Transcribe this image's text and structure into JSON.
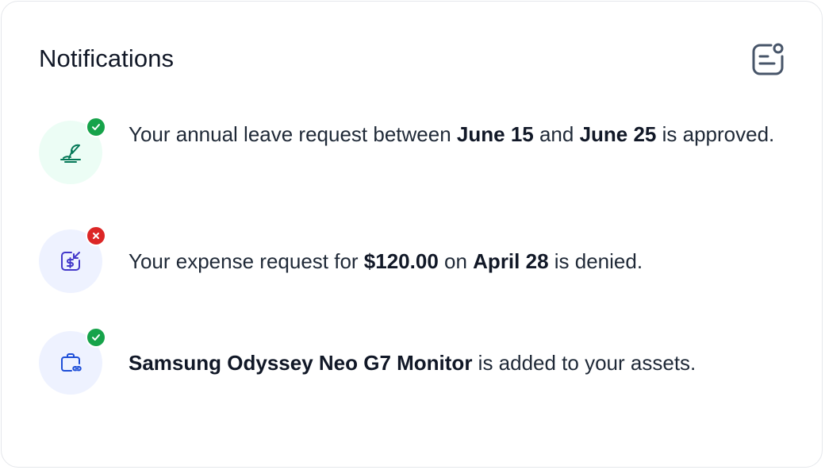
{
  "header": {
    "title": "Notifications",
    "icon": "notification-settings-icon"
  },
  "notifications": [
    {
      "icon": "beach-umbrella-icon",
      "status": "approved",
      "status_icon": "check-icon",
      "avatar_bg": "#ecfdf5",
      "icon_color": "#047857",
      "badge_color": "#16a34a",
      "parts": {
        "t1": "Your annual leave request between ",
        "b1": "June 15",
        "t2": " and ",
        "b2": "June 25",
        "t3": " is approved."
      }
    },
    {
      "icon": "expense-refund-icon",
      "status": "denied",
      "status_icon": "close-icon",
      "avatar_bg": "#eef2ff",
      "icon_color": "#4338ca",
      "badge_color": "#dc2626",
      "parts": {
        "t1": "Your expense request for ",
        "b1": "$120.00",
        "t2": " on ",
        "b2": "April 28",
        "t3": " is denied."
      }
    },
    {
      "icon": "briefcase-link-icon",
      "status": "approved",
      "status_icon": "check-icon",
      "avatar_bg": "#eef2ff",
      "icon_color": "#1d4ed8",
      "badge_color": "#16a34a",
      "parts": {
        "b1": "Samsung Odyssey Neo G7 Monitor",
        "t1": " is added to your assets."
      }
    }
  ]
}
